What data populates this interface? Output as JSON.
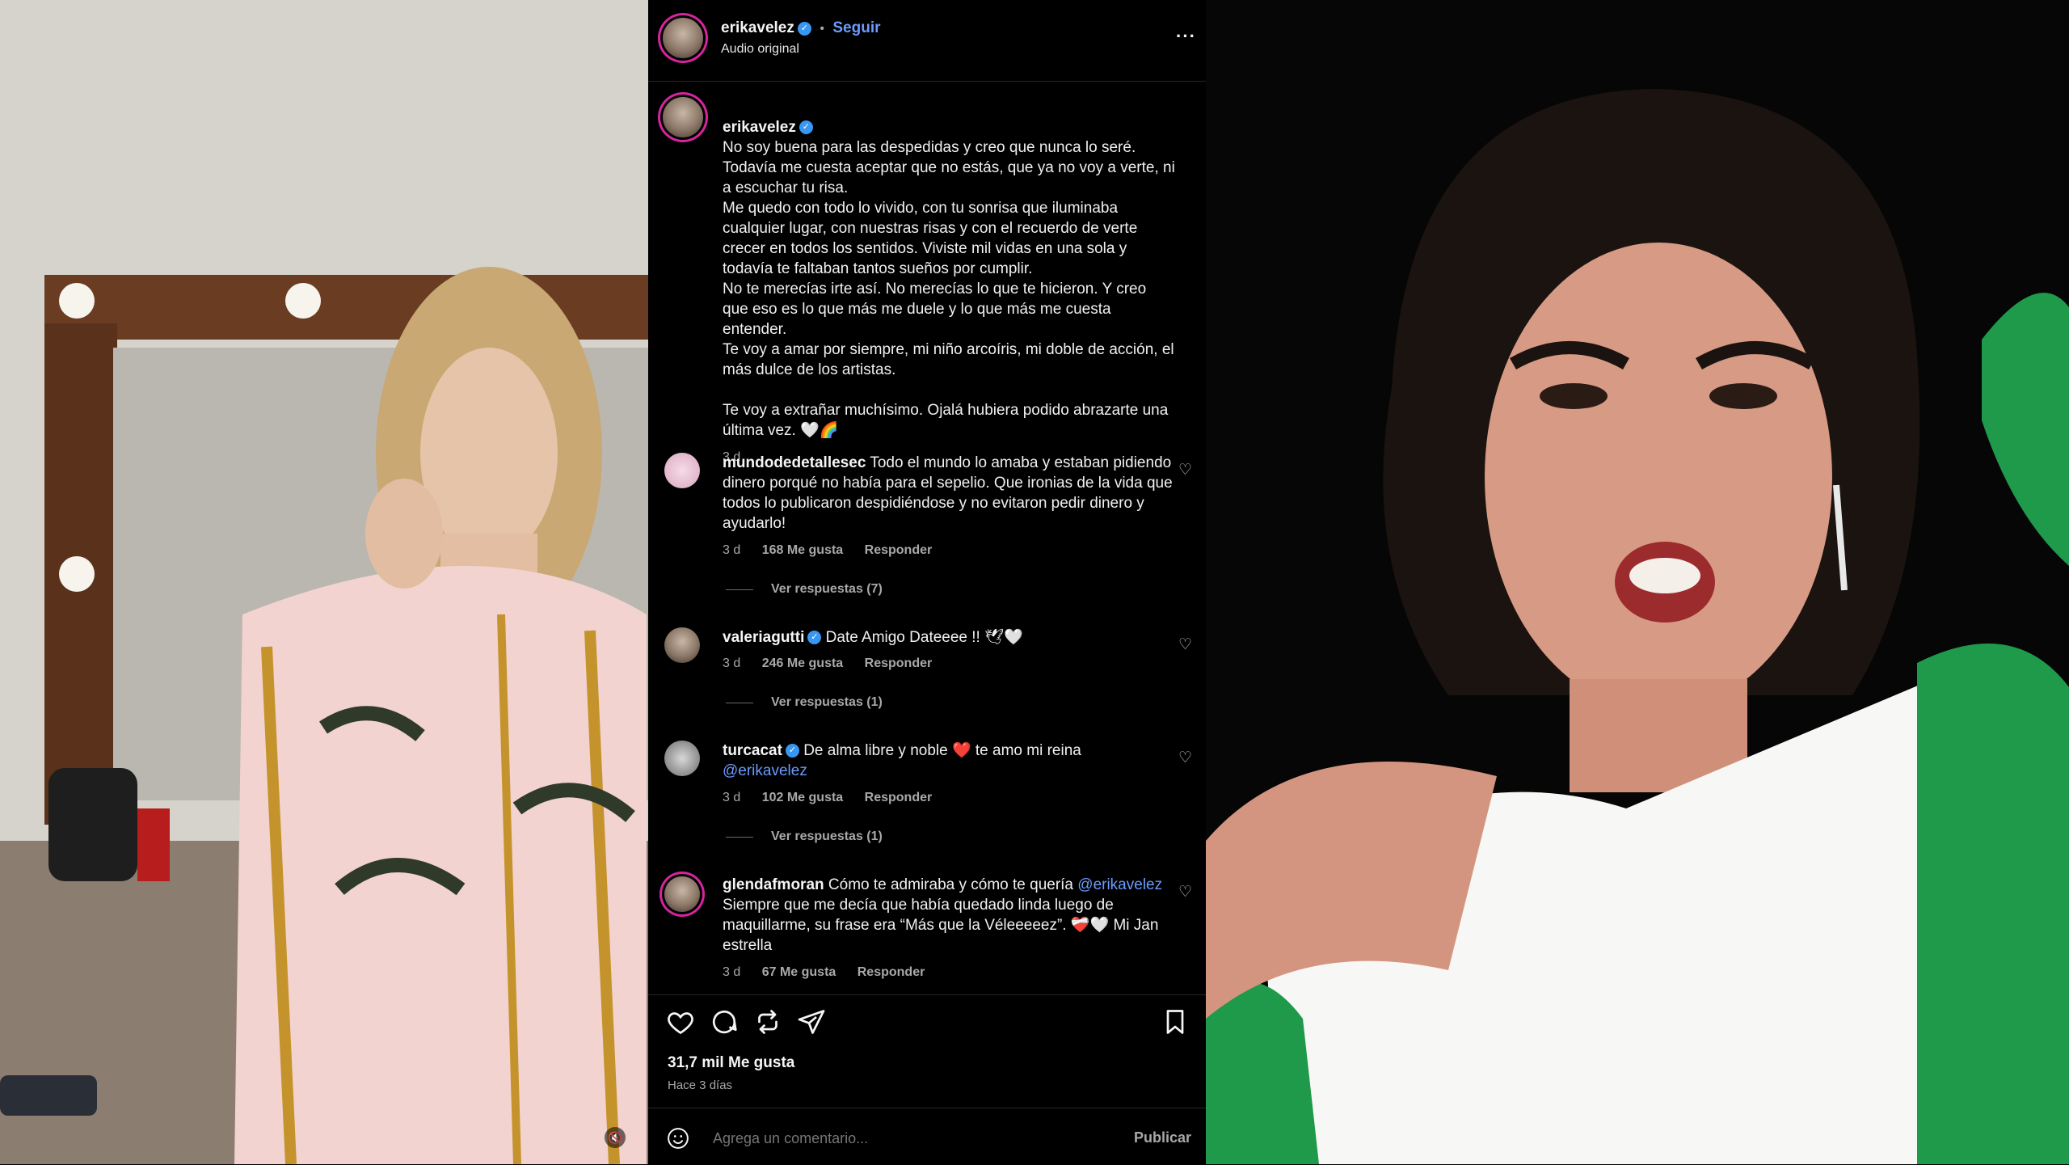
{
  "header": {
    "username": "erikavelez",
    "separator": "•",
    "follow_label": "Seguir",
    "audio_label": "Audio original",
    "more_label": "···"
  },
  "caption": {
    "username": "erikavelez",
    "text": "No soy buena para las despedidas y creo que nunca lo seré. Todavía me cuesta aceptar que no estás, que ya no voy a verte, ni a escuchar tu risa.\nMe quedo con todo lo vivido, con tu sonrisa que iluminaba cualquier lugar, con nuestras risas y con el recuerdo de verte crecer en todos los sentidos. Viviste mil vidas en una sola y todavía te faltaban tantos sueños por cumplir.\nNo te merecías irte así. No merecías lo que te hicieron. Y creo que eso es lo que más me duele y lo que más me cuesta entender.\nTe voy a amar por siempre, mi niño arcoíris, mi doble de acción, el más dulce de los artistas.\n\nTe voy a extrañar muchísimo. Ojalá hubiera podido abrazarte una última vez. 🤍🌈",
    "time": "3 d"
  },
  "comments": [
    {
      "username": "mundodedetallesec",
      "text": "Todo el mundo lo amaba y estaban pidiendo dinero porqué no había para el sepelio. Que ironias de la vida que todos lo publicaron despidiéndose y no evitaron pedir dinero y ayudarlo!",
      "mention": "",
      "time": "3 d",
      "likes": "168 Me gusta",
      "reply": "Responder",
      "view_replies": "Ver respuestas (7)"
    },
    {
      "username": "valeriagutti",
      "text": "Date Amigo Dateeee !! 🕊🤍",
      "mention": "",
      "time": "3 d",
      "likes": "246 Me gusta",
      "reply": "Responder",
      "view_replies": "Ver respuestas (1)"
    },
    {
      "username": "turcacat",
      "text": "De alma libre y noble ❤️ te amo mi reina",
      "mention": "@erikavelez",
      "time": "3 d",
      "likes": "102 Me gusta",
      "reply": "Responder",
      "view_replies": "Ver respuestas (1)"
    },
    {
      "username": "glendafmoran",
      "text": "Cómo te admiraba y cómo te quería",
      "mention": "@erikavelez",
      "text2": "Siempre que me decía que había quedado linda luego de maquillarme, su frase era “Más que la Véleeeeez”. ❤️‍🩹🤍 Mi Jan estrella",
      "time": "3 d",
      "likes": "67 Me gusta",
      "reply": "Responder"
    }
  ],
  "actions": {
    "likes_count": "31,7 mil Me gusta",
    "posted_ago": "Hace 3 días"
  },
  "composer": {
    "placeholder": "Agrega un comentario...",
    "publish_label": "Publicar"
  },
  "colors": {
    "panel_bg": "#000000",
    "link": "#6b9bfc",
    "verified": "#3897f0",
    "muted": "#a8a8a8"
  }
}
